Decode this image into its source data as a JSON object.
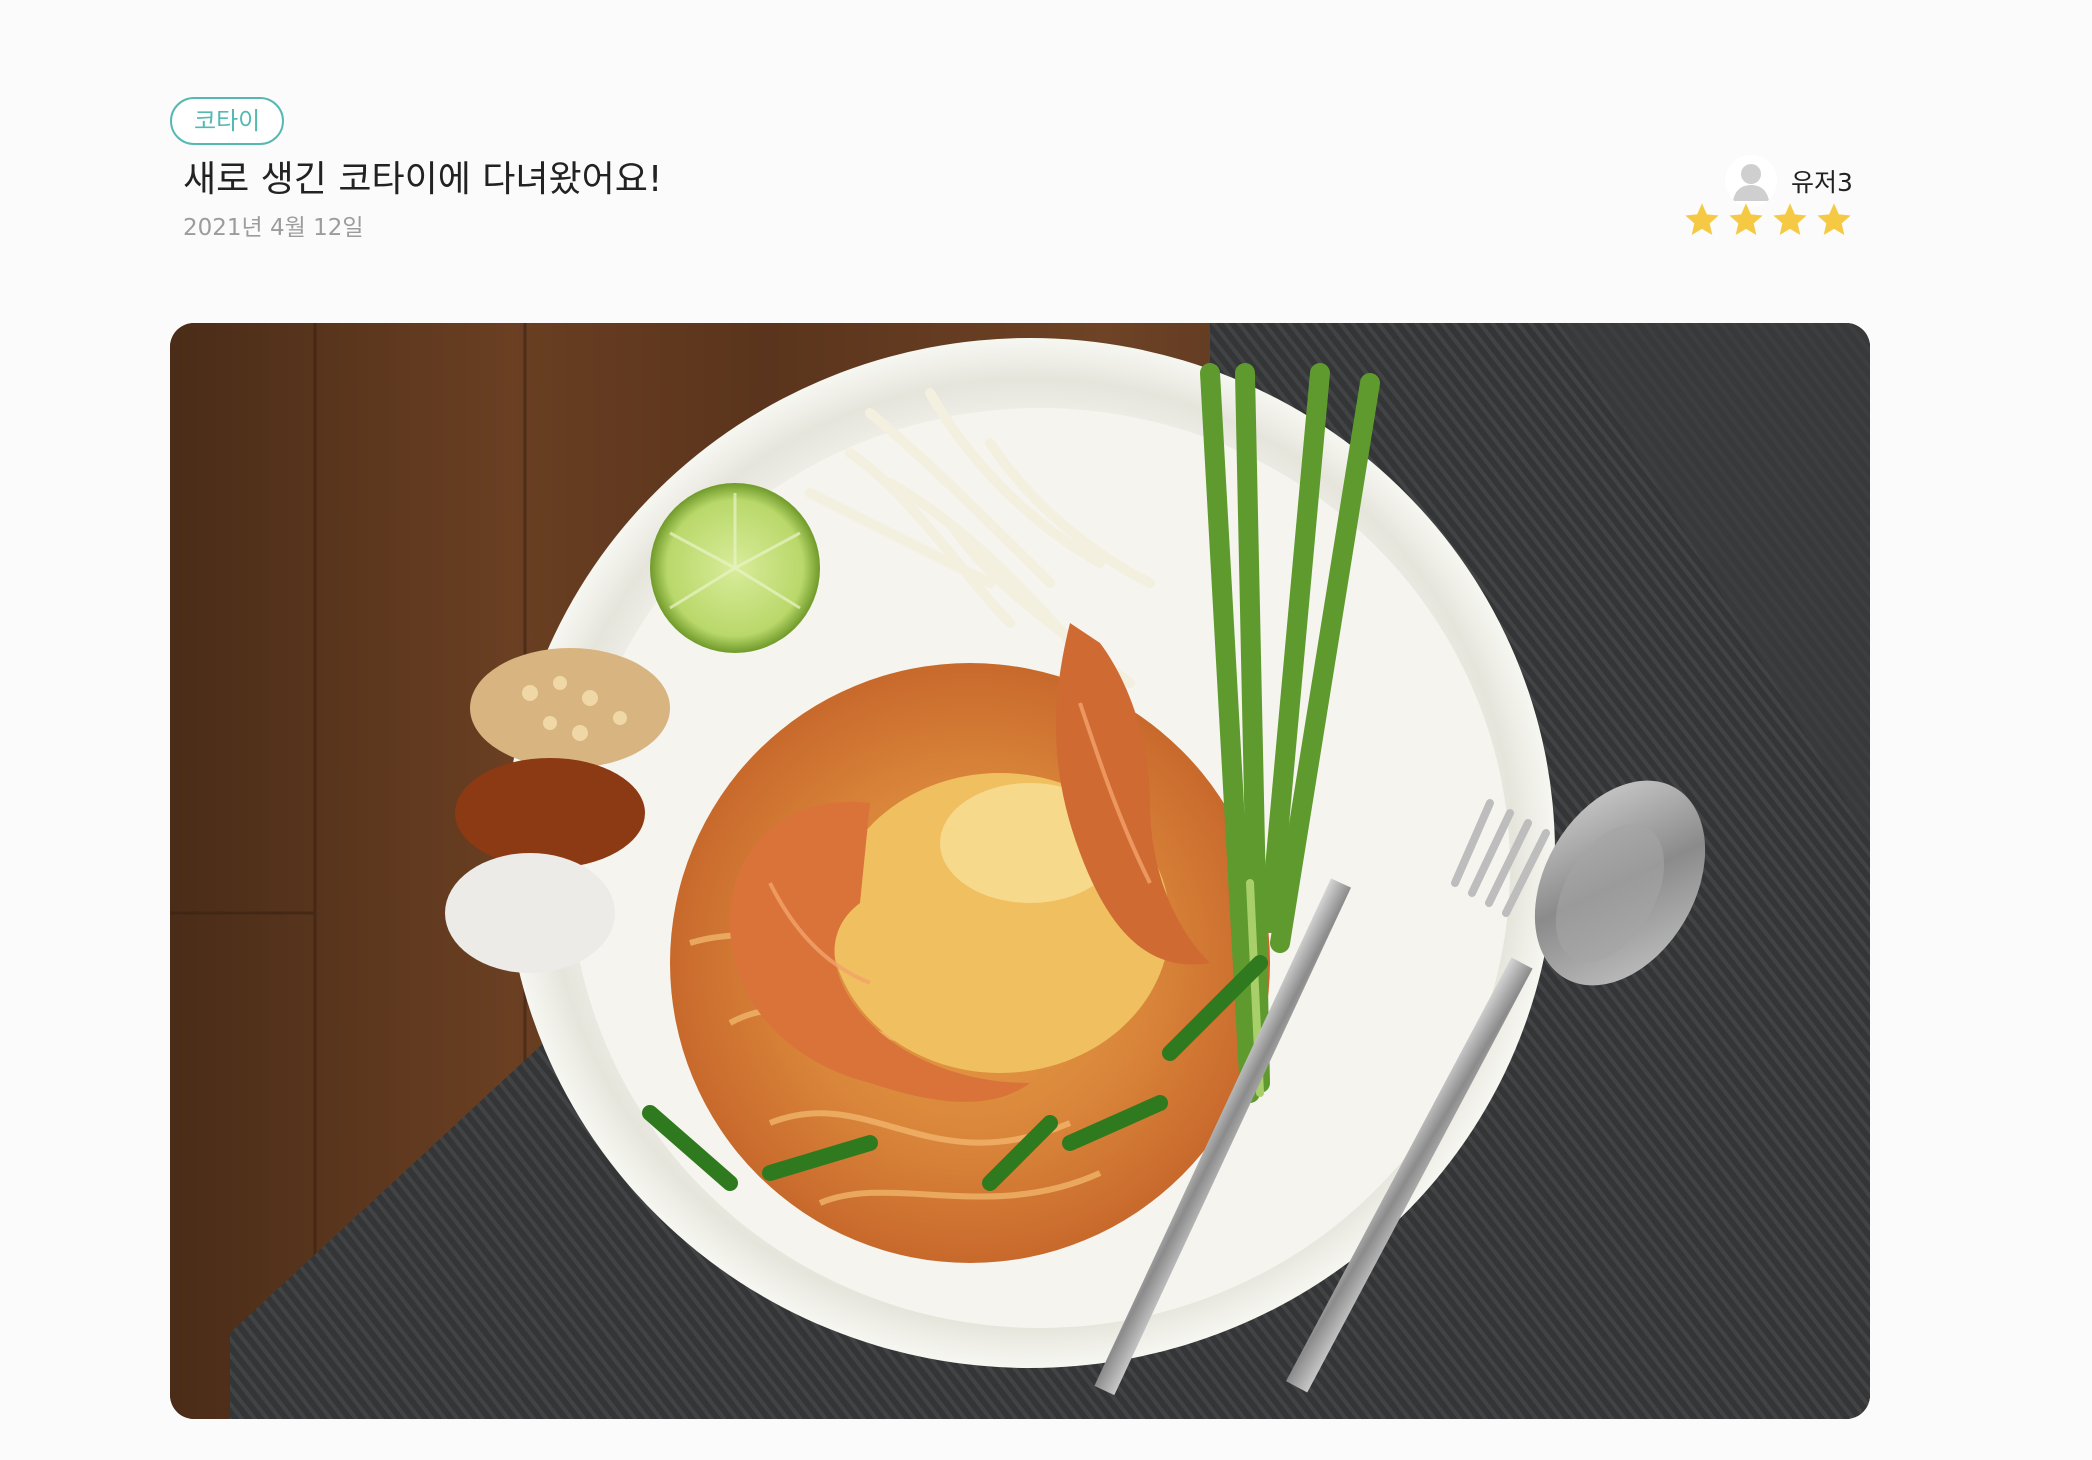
{
  "post": {
    "category_tag": "코타이",
    "title": "새로 생긴 코타이에 다녀왔어요!",
    "date": "2021년 4월 12일",
    "author": {
      "name": "유저3",
      "avatar_icon": "user-avatar-icon"
    },
    "rating": {
      "stars": 4,
      "star_icon": "star-icon",
      "star_color": "#f6c944"
    },
    "photo": {
      "subject": "pad-thai-photo"
    }
  },
  "colors": {
    "accent": "#55b9b1",
    "title": "#222222",
    "muted": "#9c9c9c",
    "background": "#fbfbfb"
  }
}
